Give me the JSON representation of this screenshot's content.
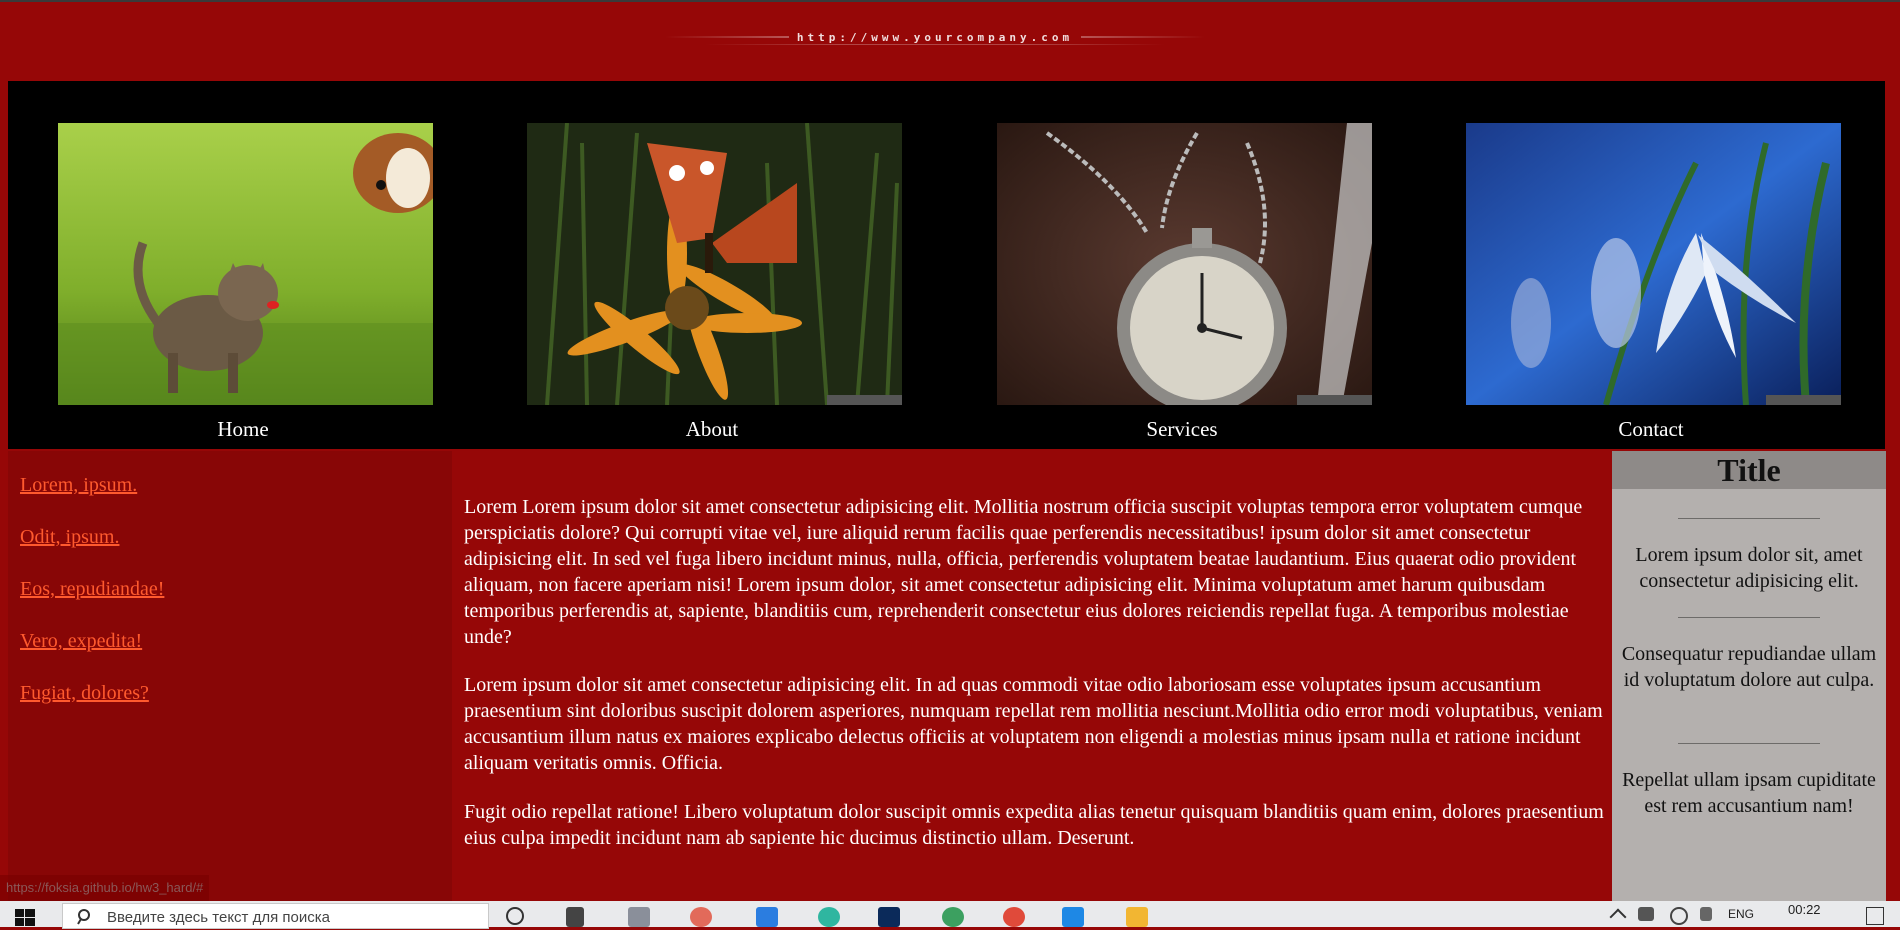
{
  "header": {
    "url_text": "http://www.yourcompany.com"
  },
  "nav": {
    "items": [
      {
        "label": "Home",
        "image": "kitten-and-puppy-photo"
      },
      {
        "label": "About",
        "image": "butterfly-on-flower-photo"
      },
      {
        "label": "Services",
        "image": "pocket-watch-photo"
      },
      {
        "label": "Contact",
        "image": "snowdrop-flower-photo"
      }
    ]
  },
  "sidebar_left": {
    "links": [
      "Lorem, ipsum.",
      "Odit, ipsum.",
      "Eos, repudiandae!",
      "Vero, expedita!",
      "Fugiat, dolores?"
    ]
  },
  "main": {
    "paragraphs": [
      "Lorem Lorem ipsum dolor sit amet consectetur adipisicing elit. Mollitia nostrum officia suscipit voluptas tempora error voluptatem cumque perspiciatis dolore? Qui corrupti vitae vel, iure aliquid rerum facilis quae perferendis necessitatibus! ipsum dolor sit amet consectetur adipisicing elit. In sed vel fuga libero incidunt minus, nulla, officia, perferendis voluptatem beatae laudantium. Eius quaerat odio provident aliquam, non facere aperiam nisi! Lorem ipsum dolor, sit amet consectetur adipisicing elit. Minima voluptatum amet harum quibusdam temporibus perferendis at, sapiente, blanditiis cum, reprehenderit consectetur eius dolores reiciendis repellat fuga. A temporibus molestiae unde?",
      "Lorem ipsum dolor sit amet consectetur adipisicing elit. In ad quas commodi vitae odio laboriosam esse voluptates ipsum accusantium praesentium sint doloribus suscipit dolorem asperiores, numquam repellat rem mollitia nesciunt.Mollitia odio error modi voluptatibus, veniam accusantium illum natus ex maiores explicabo delectus officiis at voluptatem non eligendi a molestias minus ipsam nulla et ratione incidunt aliquam veritatis omnis. Officia.",
      "Fugit odio repellat ratione! Libero voluptatum dolor suscipit omnis expedita alias tenetur quisquam blanditiis quam enim, dolores praesentium eius culpa impedit incidunt nam ab sapiente hic ducimus distinctio ullam. Deserunt."
    ]
  },
  "sidebar_right": {
    "title": "Title",
    "blocks": [
      "Lorem ipsum dolor sit, amet consectetur adipisicing elit.",
      "Consequatur repudiandae ullam id voluptatum dolore aut culpa.",
      "Repellat ullam ipsam cupiditate est rem accusantium nam!"
    ]
  },
  "status_bar": {
    "link_url": "https://foksia.github.io/hw3_hard/#"
  },
  "taskbar": {
    "search_placeholder": "Введите здесь текст для поиска",
    "language": "ENG",
    "time": "00:22"
  },
  "colors": {
    "page_background": "#960707",
    "nav_background": "#000000",
    "left_sidebar_background": "#880606",
    "link_color": "#ff5a2e",
    "right_sidebar_background": "#b4b0ae",
    "right_title_background": "#8e8a88"
  }
}
